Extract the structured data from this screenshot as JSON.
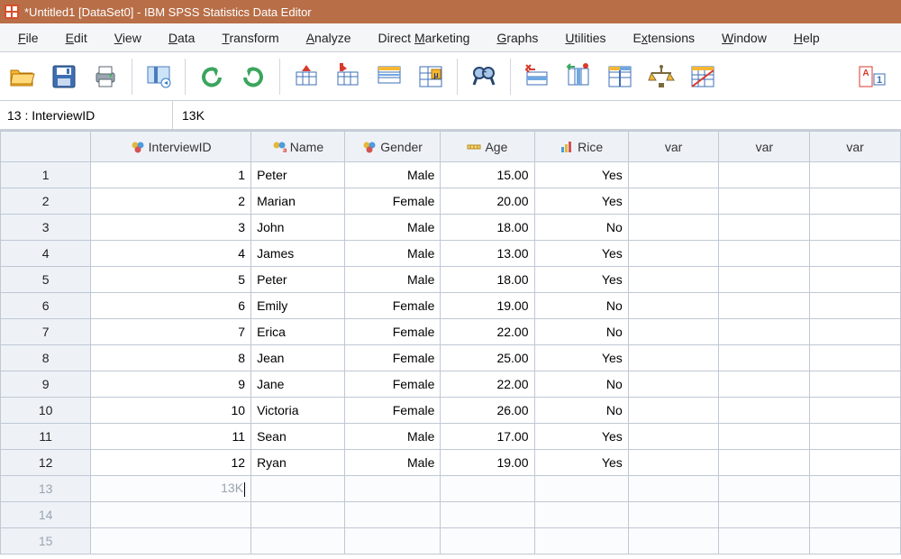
{
  "window": {
    "title": "*Untitled1 [DataSet0] - IBM SPSS Statistics Data Editor"
  },
  "menu": {
    "file": "File",
    "edit": "Edit",
    "view": "View",
    "data": "Data",
    "transform": "Transform",
    "analyze": "Analyze",
    "direct_marketing": "Direct Marketing",
    "graphs": "Graphs",
    "utilities": "Utilities",
    "extensions": "Extensions",
    "window": "Window",
    "help": "Help"
  },
  "cellref": {
    "name": "13 : InterviewID",
    "value": "13K"
  },
  "columns": {
    "interview_id": "InterviewID",
    "name": "Name",
    "gender": "Gender",
    "age": "Age",
    "rice": "Rice",
    "var": "var"
  },
  "rows": [
    {
      "n": "1",
      "id": "1",
      "name": "Peter",
      "gender": "Male",
      "age": "15.00",
      "rice": "Yes"
    },
    {
      "n": "2",
      "id": "2",
      "name": "Marian",
      "gender": "Female",
      "age": "20.00",
      "rice": "Yes"
    },
    {
      "n": "3",
      "id": "3",
      "name": "John",
      "gender": "Male",
      "age": "18.00",
      "rice": "No"
    },
    {
      "n": "4",
      "id": "4",
      "name": "James",
      "gender": "Male",
      "age": "13.00",
      "rice": "Yes"
    },
    {
      "n": "5",
      "id": "5",
      "name": "Peter",
      "gender": "Male",
      "age": "18.00",
      "rice": "Yes"
    },
    {
      "n": "6",
      "id": "6",
      "name": "Emily",
      "gender": "Female",
      "age": "19.00",
      "rice": "No"
    },
    {
      "n": "7",
      "id": "7",
      "name": "Erica",
      "gender": "Female",
      "age": "22.00",
      "rice": "No"
    },
    {
      "n": "8",
      "id": "8",
      "name": "Jean",
      "gender": "Female",
      "age": "25.00",
      "rice": "Yes"
    },
    {
      "n": "9",
      "id": "9",
      "name": "Jane",
      "gender": "Female",
      "age": "22.00",
      "rice": "No"
    },
    {
      "n": "10",
      "id": "10",
      "name": "Victoria",
      "gender": "Female",
      "age": "26.00",
      "rice": "No"
    },
    {
      "n": "11",
      "id": "11",
      "name": "Sean",
      "gender": "Male",
      "age": "17.00",
      "rice": "Yes"
    },
    {
      "n": "12",
      "id": "12",
      "name": "Ryan",
      "gender": "Male",
      "age": "19.00",
      "rice": "Yes"
    }
  ],
  "editing_row": {
    "n": "13",
    "id": "13K"
  },
  "empty_rows": [
    "14",
    "15"
  ]
}
